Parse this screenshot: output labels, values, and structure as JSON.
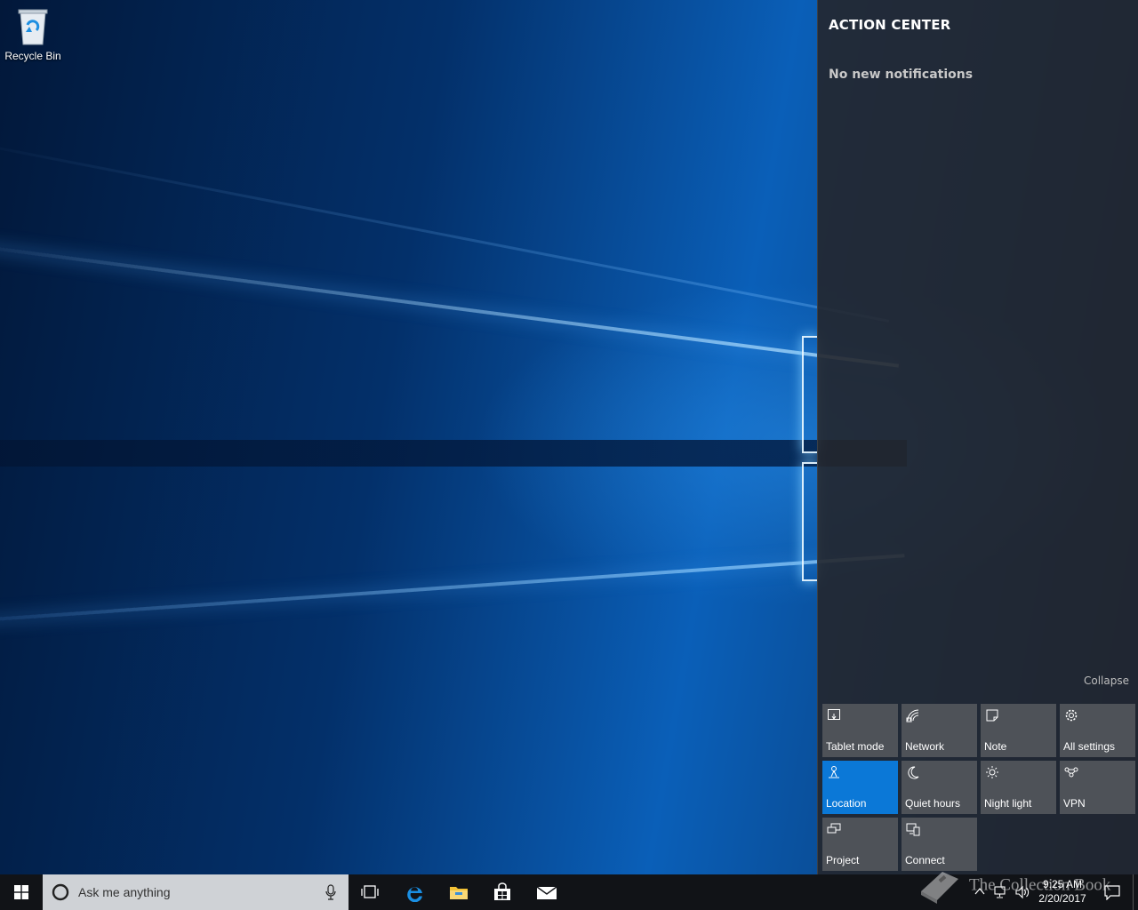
{
  "desktop": {
    "icons": [
      {
        "label": "Recycle Bin",
        "icon": "recycle-bin-icon"
      }
    ]
  },
  "action_center": {
    "title": "ACTION CENTER",
    "empty_message": "No new notifications",
    "collapse_label": "Collapse",
    "tiles": [
      {
        "label": "Tablet mode",
        "icon": "tablet-mode-icon",
        "active": false
      },
      {
        "label": "Network",
        "icon": "network-icon",
        "active": false
      },
      {
        "label": "Note",
        "icon": "note-icon",
        "active": false
      },
      {
        "label": "All settings",
        "icon": "gear-icon",
        "active": false
      },
      {
        "label": "Location",
        "icon": "location-icon",
        "active": true
      },
      {
        "label": "Quiet hours",
        "icon": "moon-icon",
        "active": false
      },
      {
        "label": "Night light",
        "icon": "sun-icon",
        "active": false
      },
      {
        "label": "VPN",
        "icon": "vpn-icon",
        "active": false
      },
      {
        "label": "Project",
        "icon": "project-icon",
        "active": false
      },
      {
        "label": "Connect",
        "icon": "connect-icon",
        "active": false
      }
    ],
    "colors": {
      "active_tile": "#0b78d7",
      "inactive_tile": "#4e5258"
    }
  },
  "taskbar": {
    "search_placeholder": "Ask me anything",
    "pinned": [
      "task-view-icon",
      "edge-icon",
      "file-explorer-icon",
      "store-icon",
      "mail-icon"
    ],
    "tray": [
      "chevron-up-icon",
      "network-tray-icon",
      "volume-icon"
    ],
    "clock": {
      "time": "9:25 AM",
      "date": "2/20/2017"
    }
  },
  "watermark": {
    "text": "The Collection Book"
  }
}
